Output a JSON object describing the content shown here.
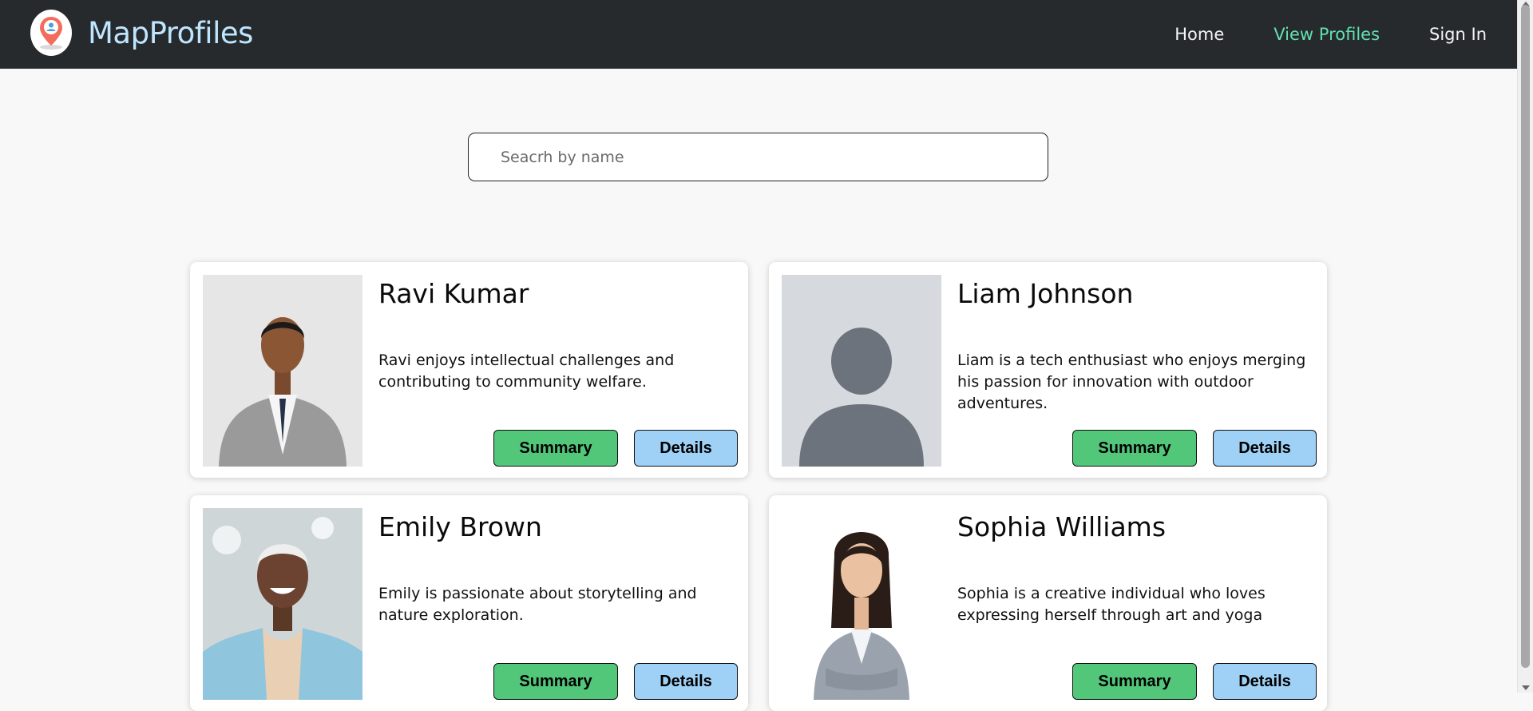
{
  "header": {
    "brand": "MapProfiles",
    "logo_icon": "map-pin-person-icon",
    "nav": [
      {
        "label": "Home",
        "active": false
      },
      {
        "label": "View Profiles",
        "active": true
      },
      {
        "label": "Sign In",
        "active": false
      }
    ],
    "active_color": "#63e0b0"
  },
  "search": {
    "placeholder": "Seacrh by name",
    "value": ""
  },
  "profiles": [
    {
      "name": "Ravi Kumar",
      "description": "Ravi enjoys intellectual challenges and contributing to community welfare.",
      "summary_label": "Summary",
      "details_label": "Details",
      "photo": "man-in-gray-suit-photo"
    },
    {
      "name": "Liam Johnson",
      "description": "Liam is a tech enthusiast who enjoys merging his passion for innovation with outdoor adventures.",
      "summary_label": "Summary",
      "details_label": "Details",
      "photo": "default-avatar-placeholder"
    },
    {
      "name": "Emily Brown",
      "description": "Emily is passionate about storytelling and nature exploration.",
      "summary_label": "Summary",
      "details_label": "Details",
      "photo": "woman-in-blue-blazer-photo"
    },
    {
      "name": "Sophia Williams",
      "description": "Sophia is a creative individual who loves expressing herself through art and yoga",
      "summary_label": "Summary",
      "details_label": "Details",
      "photo": "woman-in-gray-suit-photo"
    }
  ],
  "colors": {
    "navbar": "#262a2d",
    "summary_button": "#52c77a",
    "details_button": "#9fd0f5"
  }
}
